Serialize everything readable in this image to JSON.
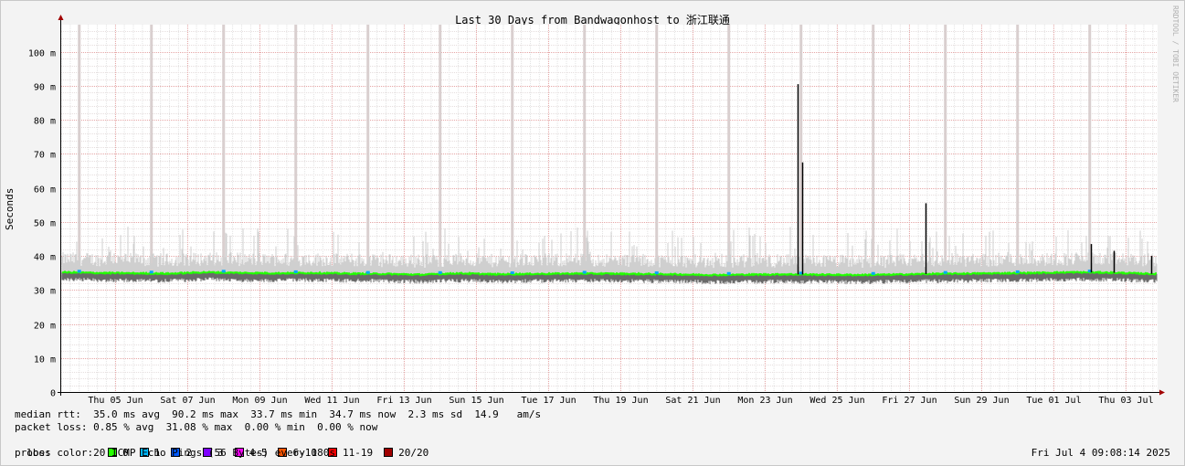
{
  "chart_data": {
    "type": "line",
    "title": "Last 30 Days from Bandwagonhost to 浙江联通",
    "ylabel": "Seconds",
    "ylim": [
      0,
      0.108
    ],
    "yticks": [
      {
        "value": 0,
        "label": "0"
      },
      {
        "value": 0.01,
        "label": "10 m"
      },
      {
        "value": 0.02,
        "label": "20 m"
      },
      {
        "value": 0.03,
        "label": "30 m"
      },
      {
        "value": 0.04,
        "label": "40 m"
      },
      {
        "value": 0.05,
        "label": "50 m"
      },
      {
        "value": 0.06,
        "label": "60 m"
      },
      {
        "value": 0.07,
        "label": "70 m"
      },
      {
        "value": 0.08,
        "label": "80 m"
      },
      {
        "value": 0.09,
        "label": "90 m"
      },
      {
        "value": 0.1,
        "label": "100 m"
      }
    ],
    "xlim": [
      "2025-06-04T00:00",
      "2025-07-04T09:08"
    ],
    "xticks": [
      {
        "date": "2025-06-05T12:00",
        "label": "Thu 05 Jun"
      },
      {
        "date": "2025-06-07T12:00",
        "label": "Sat 07 Jun"
      },
      {
        "date": "2025-06-09T12:00",
        "label": "Mon 09 Jun"
      },
      {
        "date": "2025-06-11T12:00",
        "label": "Wed 11 Jun"
      },
      {
        "date": "2025-06-13T12:00",
        "label": "Fri 13 Jun"
      },
      {
        "date": "2025-06-15T12:00",
        "label": "Sun 15 Jun"
      },
      {
        "date": "2025-06-17T12:00",
        "label": "Tue 17 Jun"
      },
      {
        "date": "2025-06-19T12:00",
        "label": "Thu 19 Jun"
      },
      {
        "date": "2025-06-21T12:00",
        "label": "Sat 21 Jun"
      },
      {
        "date": "2025-06-23T12:00",
        "label": "Mon 23 Jun"
      },
      {
        "date": "2025-06-25T12:00",
        "label": "Wed 25 Jun"
      },
      {
        "date": "2025-06-27T12:00",
        "label": "Fri 27 Jun"
      },
      {
        "date": "2025-06-29T12:00",
        "label": "Sun 29 Jun"
      },
      {
        "date": "2025-07-01T12:00",
        "label": "Tue 01 Jul"
      },
      {
        "date": "2025-07-03T12:00",
        "label": "Thu 03 Jul"
      }
    ],
    "series": [
      {
        "name": "0",
        "color": "#00ff00",
        "x": [
          "2025-06-04T00:00",
          "2025-06-05T00:00",
          "2025-06-06T00:00",
          "2025-06-07T00:00",
          "2025-06-08T00:00",
          "2025-06-09T00:00",
          "2025-06-10T00:00",
          "2025-06-11T00:00",
          "2025-06-12T00:00",
          "2025-06-13T00:00",
          "2025-06-14T00:00",
          "2025-06-15T00:00",
          "2025-06-16T00:00",
          "2025-06-17T00:00",
          "2025-06-18T00:00",
          "2025-06-19T00:00",
          "2025-06-20T00:00",
          "2025-06-21T00:00",
          "2025-06-22T00:00",
          "2025-06-23T00:00",
          "2025-06-24T00:00",
          "2025-06-25T00:00",
          "2025-06-26T00:00",
          "2025-06-27T00:00",
          "2025-06-28T00:00",
          "2025-06-29T00:00",
          "2025-06-30T00:00",
          "2025-07-01T00:00",
          "2025-07-02T00:00",
          "2025-07-03T00:00",
          "2025-07-04T09:08"
        ],
        "y": [
          0.0352,
          0.035,
          0.0349,
          0.0348,
          0.0352,
          0.035,
          0.0349,
          0.035,
          0.0348,
          0.0347,
          0.0345,
          0.0349,
          0.0346,
          0.0347,
          0.0348,
          0.0348,
          0.0347,
          0.0346,
          0.0344,
          0.0345,
          0.0346,
          0.0345,
          0.0344,
          0.0345,
          0.0347,
          0.0348,
          0.0349,
          0.035,
          0.0352,
          0.0351,
          0.0347
        ]
      }
    ],
    "spikes": [
      {
        "date": "2025-06-24T10:00",
        "value": 0.0905
      },
      {
        "date": "2025-06-24T12:30",
        "value": 0.0675
      },
      {
        "date": "2025-06-27T23:00",
        "value": 0.0555
      },
      {
        "date": "2025-07-02T13:00",
        "value": 0.0435
      },
      {
        "date": "2025-07-03T04:00",
        "value": 0.0415
      },
      {
        "date": "2025-07-04T05:00",
        "value": 0.04
      }
    ],
    "grid": true
  },
  "stats": {
    "median_rtt": "median rtt:  35.0 ms avg  90.2 ms max  33.7 ms min  34.7 ms now  2.3 ms sd  14.9   am/s",
    "packet_loss": "packet loss: 0.85 % avg  31.08 % max  0.00 % min  0.00 % now",
    "loss_label": "loss color:",
    "loss_colors": [
      {
        "label": "0",
        "color": "#26ff00"
      },
      {
        "label": "1",
        "color": "#00b8ff"
      },
      {
        "label": "2",
        "color": "#0059ff"
      },
      {
        "label": "3",
        "color": "#7e00ff"
      },
      {
        "label": "4-5",
        "color": "#ff00ff"
      },
      {
        "label": "6-10",
        "color": "#ff5500"
      },
      {
        "label": "11-19",
        "color": "#ff0000"
      },
      {
        "label": "20/20",
        "color": "#a10000"
      }
    ],
    "probe": "probe:       20 ICMP Echo Pings (56 Bytes) every 180s",
    "timestamp": "Fri Jul  4 09:08:14 2025"
  },
  "watermark": "RRDTOOL / TOBI OETIKER"
}
